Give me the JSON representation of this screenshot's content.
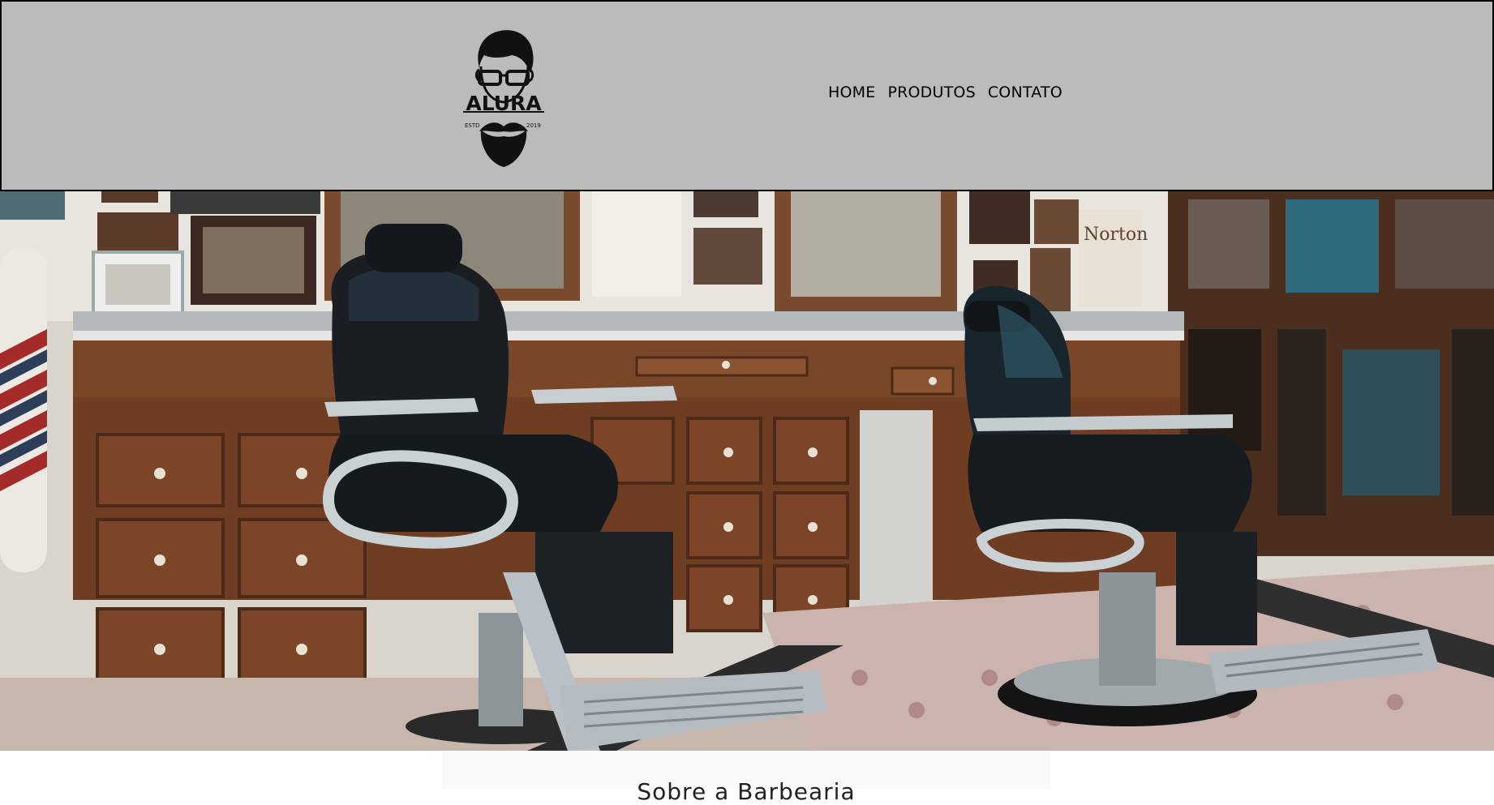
{
  "header": {
    "logo": {
      "icon": "bearded-man-logo-icon",
      "wordmark": "ALURA",
      "est_left": "ESTD",
      "est_right": "2019"
    },
    "nav": [
      {
        "label": "HOME"
      },
      {
        "label": "PRODUTOS"
      },
      {
        "label": "CONTATO"
      }
    ]
  },
  "hero": {
    "image": "barbershop-photo"
  },
  "section": {
    "title": "Sobre a Barbearia"
  },
  "colors": {
    "header_bg": "#bbbbbb",
    "header_border": "#000000",
    "nav_text": "#000000",
    "page_bg": "#ffffff"
  }
}
